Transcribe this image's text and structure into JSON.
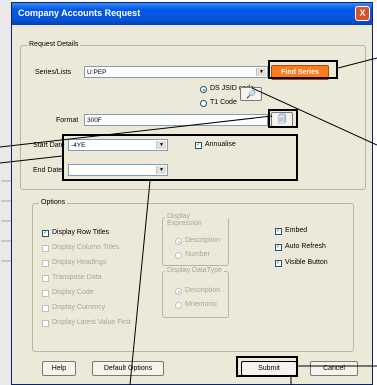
{
  "window": {
    "title": "Company Accounts Request",
    "close_glyph": "X"
  },
  "request_details": {
    "legend": "Request Details",
    "series_label": "Series/Lists",
    "series_value": "U:PEP",
    "find_series_label": "Find Series",
    "radio_dsjsid": "DS JSID code",
    "radio_t1": "T1 Code",
    "format_label": "Format",
    "format_value": "300F",
    "start_date_label": "Start Date",
    "start_date_value": "-4YE",
    "annualise_label": "Annualise",
    "end_date_label": "End Date",
    "end_date_value": ""
  },
  "options": {
    "legend": "Options",
    "left_checks": [
      {
        "label": "Display Row Titles",
        "checked": true,
        "enabled": true
      },
      {
        "label": "Display Column Titles",
        "checked": false,
        "enabled": false
      },
      {
        "label": "Display Headings",
        "checked": false,
        "enabled": false
      },
      {
        "label": "Transpose Data",
        "checked": false,
        "enabled": false
      },
      {
        "label": "Display Code",
        "checked": false,
        "enabled": false
      },
      {
        "label": "Display Currency",
        "checked": false,
        "enabled": false
      },
      {
        "label": "Display Latest Value First",
        "checked": false,
        "enabled": false
      }
    ],
    "display_expression": {
      "legend": "Display Expression",
      "opt1": "Description",
      "opt2": "Number"
    },
    "display_datatype": {
      "legend": "Display DataType",
      "opt1": "Description",
      "opt2": "Mnemonic"
    },
    "right_checks": [
      {
        "label": "Embed",
        "checked": true
      },
      {
        "label": "Auto Refresh",
        "checked": true
      },
      {
        "label": "Visible Button",
        "checked": true
      }
    ]
  },
  "footer": {
    "help_label": "Help",
    "default_options_label": "Default Options",
    "submit_label": "Submit",
    "cancel_label": "Cancel"
  },
  "icons": {
    "find_icon": "binoculars-icon",
    "format_icon": "format-picker-icon",
    "check_glyph": "✓"
  },
  "colors": {
    "accent": "#ff7a1a",
    "titlebar": "#0058e6",
    "dialog_bg": "#ece9d8"
  }
}
